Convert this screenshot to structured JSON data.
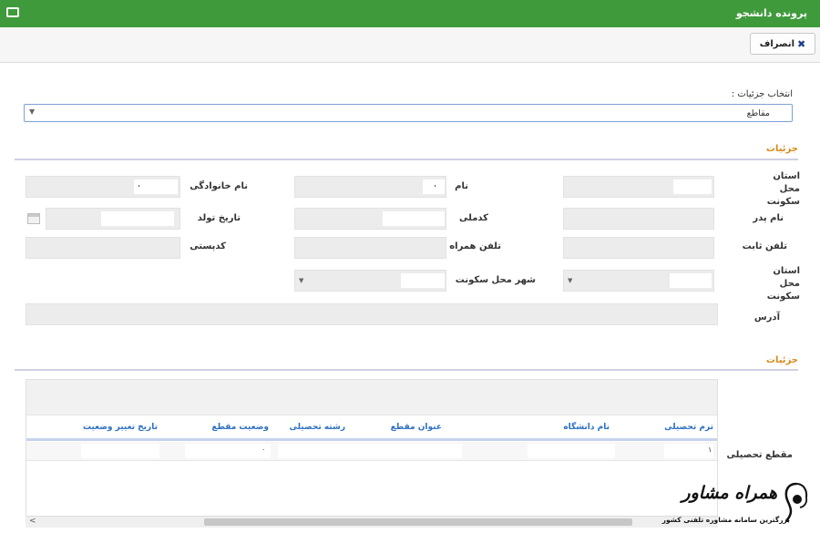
{
  "window": {
    "title": "پرونده دانشجو"
  },
  "toolbar": {
    "back_label": "انصراف"
  },
  "details_select": {
    "label": "انتخاب جزئیات :",
    "value": "مقاطع"
  },
  "section1": {
    "title": "جزئیات"
  },
  "form": {
    "province_label": "استان محل سکونت",
    "first_name_label": "نام",
    "first_name_value": "،",
    "last_name_label": "نام خانوادگی",
    "last_name_value": "،",
    "father_name_label": "نام پدر",
    "national_code_label": "کدملی",
    "birth_date_label": "تاریخ تولد",
    "phone_label": "تلفن ثابت",
    "mobile_label": "تلفن همراه",
    "postal_code_label": "کدپستی",
    "province2_label": "استان محل سکونت",
    "city_label": "شهر محل سکونت",
    "address_label": "آدرس"
  },
  "section2": {
    "title": "جزئیات"
  },
  "grid": {
    "side_label": "مقطع تحصیلی",
    "columns": [
      "ترم تحصیلی",
      "نام دانشگاه",
      "عنوان مقطع",
      "رشته تحصیلی",
      "وضعیت مقطع",
      "تاریخ تغییر وضعیت"
    ],
    "row": {
      "term": "۱",
      "status": "۰"
    }
  },
  "watermark": {
    "title": "همراه مشاور",
    "subtitle": "بزرگترین سامانه مشاوره تلفنی کشور"
  }
}
